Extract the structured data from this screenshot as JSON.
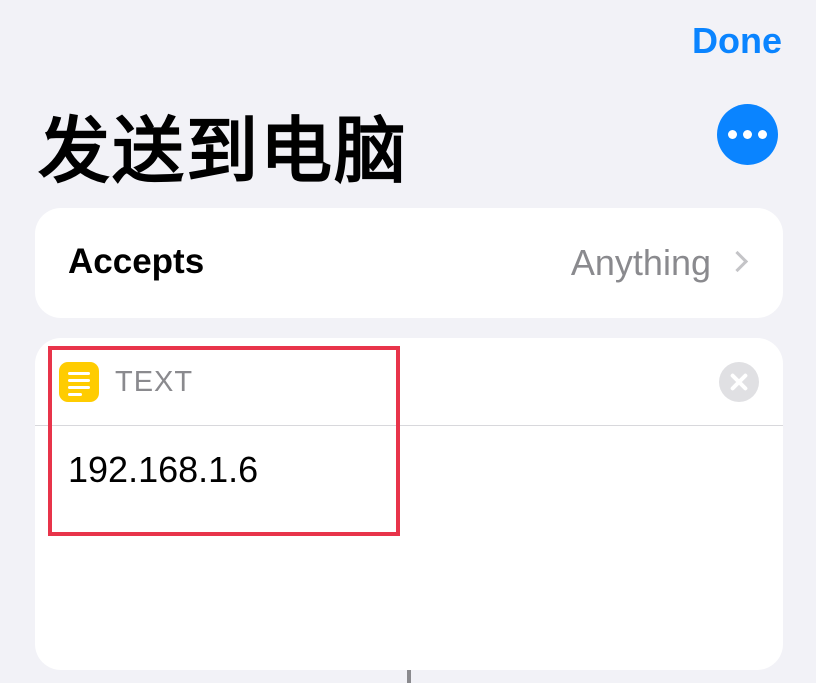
{
  "nav": {
    "done_label": "Done"
  },
  "page": {
    "title": "发送到电脑"
  },
  "accepts": {
    "label": "Accepts",
    "value": "Anything"
  },
  "text_action": {
    "label": "TEXT",
    "value": "192.168.1.6"
  },
  "colors": {
    "accent": "#0a84ff",
    "text_icon": "#ffcc00",
    "highlight": "#e8344a",
    "background": "#f2f2f7"
  },
  "icons": {
    "more": "more-icon",
    "text": "text-lines-icon",
    "clear": "clear-icon",
    "chevron": "chevron-right-icon"
  }
}
